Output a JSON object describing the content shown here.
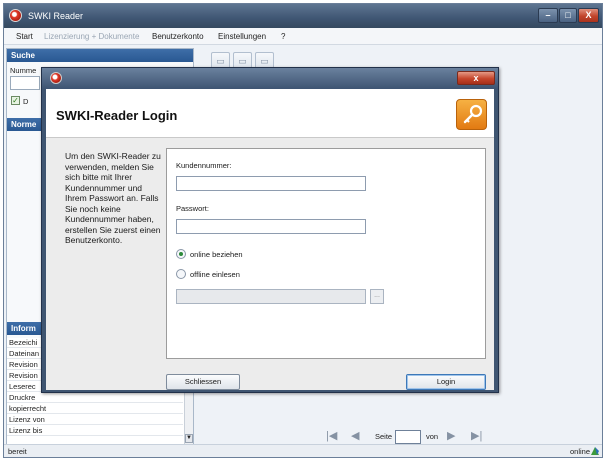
{
  "app": {
    "title": "SWKI Reader"
  },
  "window_controls": {
    "minimize": "–",
    "maximize": "□",
    "close": "X"
  },
  "menu": [
    "Start",
    "Lizenzierung + Dokumente",
    "Benutzerkonto",
    "Einstellungen",
    "?"
  ],
  "left_panel": {
    "search_header": "Suche",
    "search_label": "Numme",
    "checkbox_label": "D",
    "norms_header": "Norme",
    "info_header": "Inform",
    "info_rows": [
      "Bezeichi",
      "Dateinan",
      "Revision",
      "Revision",
      "Leserec",
      "Druckre",
      "kopierrecht",
      "Lizenz von",
      "Lizenz bis"
    ]
  },
  "toolbar": {
    "icons": [
      "a",
      "b",
      "c"
    ]
  },
  "pager": {
    "page_label": "Seite",
    "of_label": "von",
    "page_value": ""
  },
  "status": {
    "text": "bereit",
    "online": "online"
  },
  "dialog": {
    "title": "",
    "close_label": "x",
    "heading": "SWKI-Reader Login",
    "intro": "Um den SWKI-Reader zu verwenden, melden Sie sich bitte mit Ihrer Kundennummer und Ihrem Passwort an. Falls Sie noch keine Kundennummer haben, erstellen Sie zuerst einen Benutzerkonto.",
    "customer_label": "Kundennummer:",
    "customer_value": "",
    "password_label": "Passwort:",
    "password_value": "",
    "radio_online": "online beziehen",
    "radio_offline": "offline einlesen",
    "browse_label": "...",
    "close_button": "Schliessen",
    "login_button": "Login"
  },
  "colors": {
    "titlebar": "#3f5673",
    "accent_blue": "#295892",
    "key_orange": "#e27a12"
  }
}
